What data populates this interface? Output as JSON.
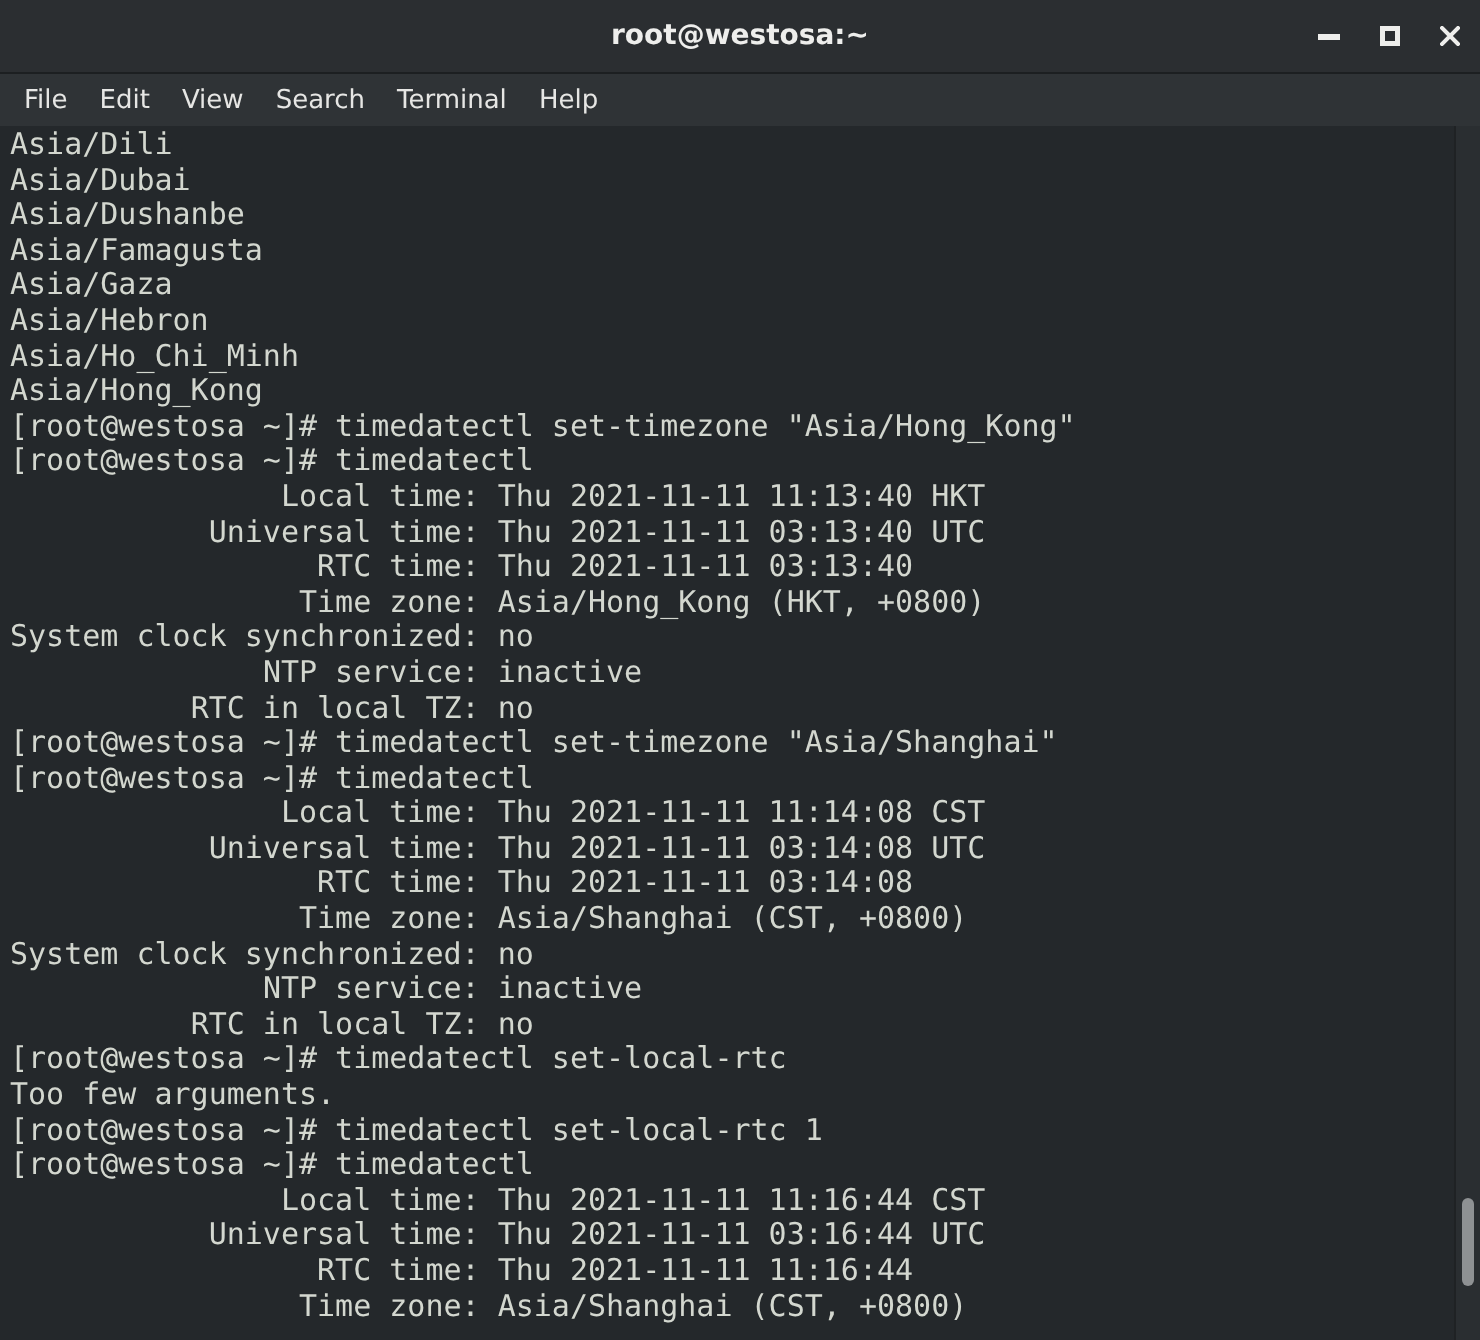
{
  "window": {
    "title": "root@westosa:~"
  },
  "menu": [
    "File",
    "Edit",
    "View",
    "Search",
    "Terminal",
    "Help"
  ],
  "terminal": {
    "lines": [
      "Asia/Dili",
      "Asia/Dubai",
      "Asia/Dushanbe",
      "Asia/Famagusta",
      "Asia/Gaza",
      "Asia/Hebron",
      "Asia/Ho_Chi_Minh",
      "Asia/Hong_Kong",
      "[root@westosa ~]# timedatectl set-timezone \"Asia/Hong_Kong\"",
      "[root@westosa ~]# timedatectl",
      "               Local time: Thu 2021-11-11 11:13:40 HKT",
      "           Universal time: Thu 2021-11-11 03:13:40 UTC",
      "                 RTC time: Thu 2021-11-11 03:13:40",
      "                Time zone: Asia/Hong_Kong (HKT, +0800)",
      "System clock synchronized: no",
      "              NTP service: inactive",
      "          RTC in local TZ: no",
      "[root@westosa ~]# timedatectl set-timezone \"Asia/Shanghai\"",
      "[root@westosa ~]# timedatectl",
      "               Local time: Thu 2021-11-11 11:14:08 CST",
      "           Universal time: Thu 2021-11-11 03:14:08 UTC",
      "                 RTC time: Thu 2021-11-11 03:14:08",
      "                Time zone: Asia/Shanghai (CST, +0800)",
      "System clock synchronized: no",
      "              NTP service: inactive",
      "          RTC in local TZ: no",
      "[root@westosa ~]# timedatectl set-local-rtc",
      "Too few arguments.",
      "[root@westosa ~]# timedatectl set-local-rtc 1",
      "[root@westosa ~]# timedatectl",
      "               Local time: Thu 2021-11-11 11:16:44 CST",
      "           Universal time: Thu 2021-11-11 03:16:44 UTC",
      "                 RTC time: Thu 2021-11-11 11:16:44",
      "                Time zone: Asia/Shanghai (CST, +0800)"
    ]
  }
}
